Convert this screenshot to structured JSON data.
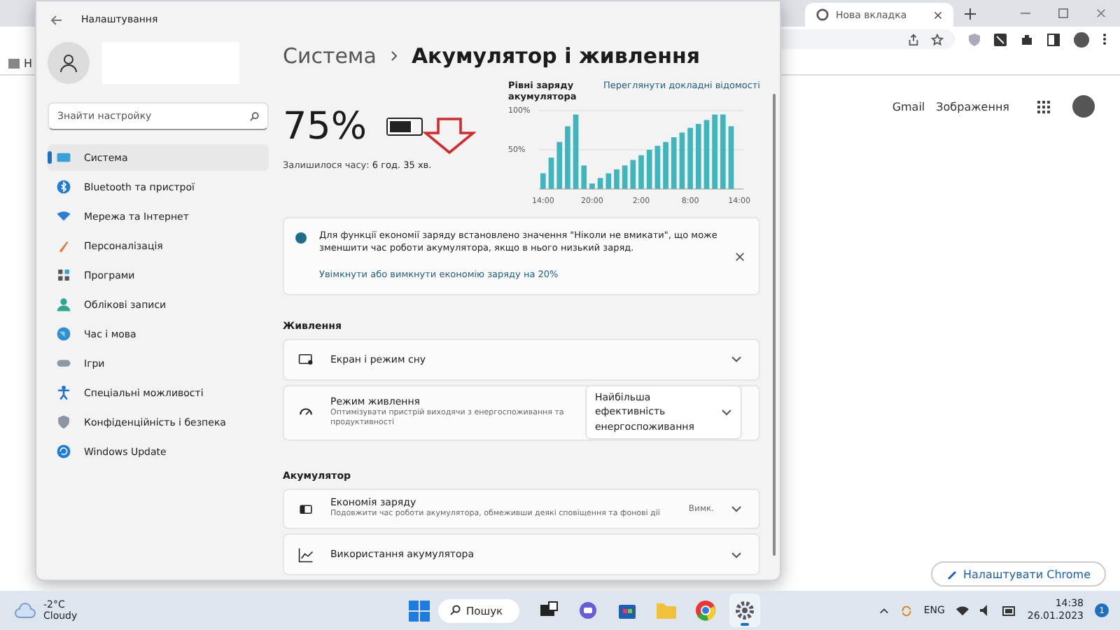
{
  "browser": {
    "tabs": [
      {
        "label": "Нова вкладка",
        "selected": true
      }
    ],
    "bookmark": "Н",
    "links": [
      "Gmail",
      "Зображення"
    ],
    "customize_button": "Налаштувати Chrome"
  },
  "settings": {
    "title": "Налаштування",
    "search": {
      "placeholder": "Знайти настройку"
    },
    "nav": [
      {
        "label": "Система",
        "selected": true
      },
      {
        "label": "Bluetooth та пристрої",
        "selected": false
      },
      {
        "label": "Мережа та Інтернет",
        "selected": false
      },
      {
        "label": "Персоналізація",
        "selected": false
      },
      {
        "label": "Програми",
        "selected": false
      },
      {
        "label": "Облікові записи",
        "selected": false
      },
      {
        "label": "Час і мова",
        "selected": false
      },
      {
        "label": "Ігри",
        "selected": false
      },
      {
        "label": "Спеціальні можливості",
        "selected": false
      },
      {
        "label": "Конфіденційність і безпека",
        "selected": false
      },
      {
        "label": "Windows Update",
        "selected": false
      }
    ],
    "breadcrumb": {
      "parent": "Система",
      "current": "Акумулятор і живлення"
    },
    "battery": {
      "percent": "75%",
      "level": 0.75,
      "remaining_label": "Залишилося часу:",
      "remaining": "6 год. 35 хв."
    },
    "chart": {
      "link": "Переглянути докладні відомості",
      "chart_data": {
        "type": "bar",
        "title": "Рівні заряду акумулятора",
        "categories": [
          "14:00",
          null,
          null,
          null,
          null,
          null,
          "20:00",
          null,
          null,
          null,
          null,
          null,
          "2:00",
          null,
          null,
          null,
          null,
          null,
          "8:00",
          null,
          null,
          null,
          null,
          null,
          "14:00"
        ],
        "series": [
          {
            "color": "#3fb5bd",
            "values": [
              20,
              40,
              60,
              80,
              95,
              30,
              7,
              14,
              20,
              25,
              30,
              37,
              43,
              50,
              55,
              60,
              66,
              72,
              78,
              83,
              88,
              95,
              95,
              80,
              null
            ]
          }
        ],
        "ylim": [
          0,
          100
        ],
        "yticks": [
          {
            "value": 50,
            "label": "50%"
          },
          {
            "value": 100,
            "label": "100%"
          }
        ]
      }
    },
    "notice": {
      "text": "Для функції економії заряду встановлено значення \"Ніколи не вмикати\", що може зменшити час роботи акумулятора, якщо в нього низький заряд.",
      "link": "Увімкнути або вимкнути економію заряду на 20%"
    },
    "sections": [
      {
        "heading": "Живлення",
        "rows": [
          {
            "kind": "expander",
            "title": "Екран і режим сну"
          },
          {
            "kind": "dropdown",
            "title": "Режим живлення",
            "subtitle": "Оптимізувати пристрій виходячи з енергоспоживання та продуктивності",
            "value": "Найбільша ефективність енергоспоживання"
          }
        ]
      },
      {
        "heading": "Акумулятор",
        "rows": [
          {
            "kind": "expander",
            "title": "Економія заряду",
            "subtitle": "Подовжити час роботи акумулятора, обмеживши деякі сповіщення та фонові дії",
            "value": "Вимк."
          },
          {
            "kind": "expander",
            "title": "Використання акумулятора"
          }
        ]
      }
    ]
  },
  "taskbar": {
    "weather": {
      "temp": "-2°C",
      "condition": "Cloudy"
    },
    "search": "Пошук",
    "apps": [
      {
        "active": false
      },
      {
        "active": false
      },
      {
        "active": false
      },
      {
        "active": false
      },
      {
        "active": false
      },
      {
        "active": true
      }
    ],
    "tray": {
      "language": "ENG",
      "time": "14:38",
      "date": "26.01.2023",
      "badge": "1"
    }
  }
}
